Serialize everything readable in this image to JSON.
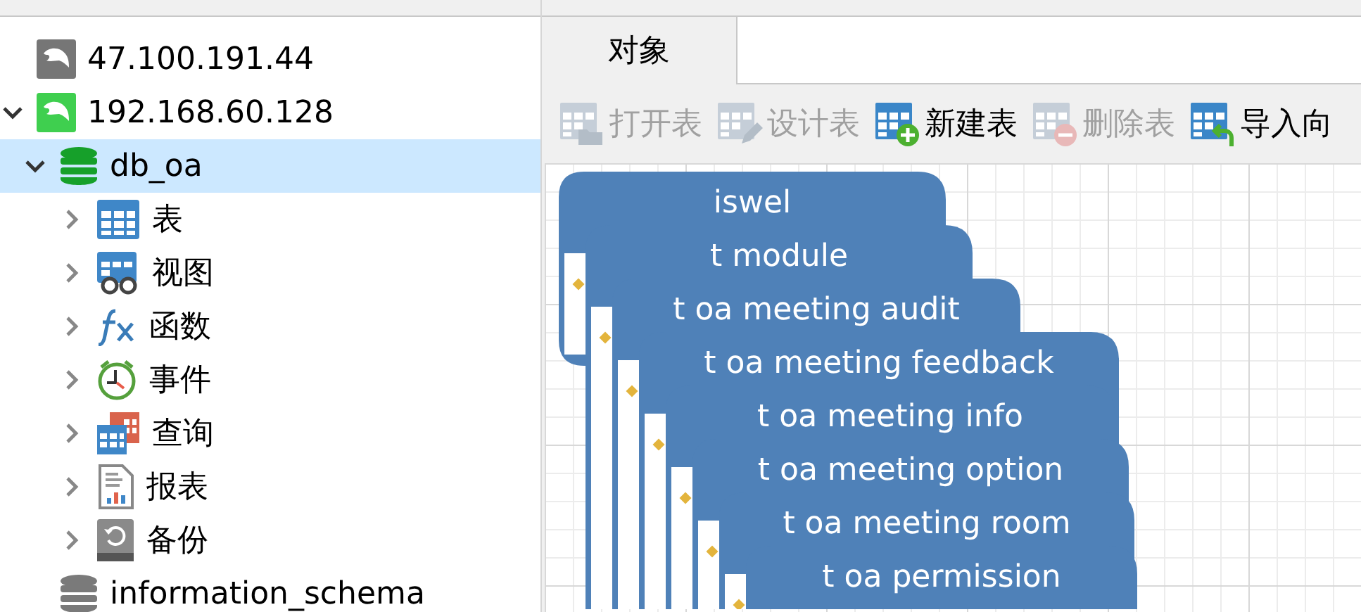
{
  "sidebar": {
    "tree": [
      {
        "label": "47.100.191.44",
        "kind": "connection",
        "open": false,
        "selected": false
      },
      {
        "label": "192.168.60.128",
        "kind": "connection",
        "open": true,
        "selected": false,
        "expanded": true,
        "children": [
          {
            "label": "db_oa",
            "kind": "database",
            "open": true,
            "selected": true,
            "expanded": true,
            "children": [
              {
                "label": "表",
                "kind": "tables",
                "selected": false,
                "expanded": false
              },
              {
                "label": "视图",
                "kind": "views",
                "selected": false,
                "expanded": false
              },
              {
                "label": "函数",
                "kind": "functions",
                "selected": false,
                "expanded": false
              },
              {
                "label": "事件",
                "kind": "events",
                "selected": false,
                "expanded": false
              },
              {
                "label": "查询",
                "kind": "queries",
                "selected": false,
                "expanded": false
              },
              {
                "label": "报表",
                "kind": "reports",
                "selected": false,
                "expanded": false
              },
              {
                "label": "备份",
                "kind": "backups",
                "selected": false,
                "expanded": false
              }
            ]
          },
          {
            "label": "information_schema",
            "kind": "database",
            "open": false,
            "selected": false
          }
        ]
      }
    ]
  },
  "tabs": [
    {
      "label": "对象",
      "selected": true
    }
  ],
  "toolbar": [
    {
      "label": "打开表",
      "kind": "open",
      "disabled": true
    },
    {
      "label": "设计表",
      "kind": "design",
      "disabled": true
    },
    {
      "label": "新建表",
      "kind": "new",
      "disabled": false
    },
    {
      "label": "删除表",
      "kind": "delete",
      "disabled": true
    },
    {
      "label": "导入向",
      "kind": "import",
      "disabled": false
    }
  ],
  "diagram": {
    "tables": [
      {
        "name": "iswel"
      },
      {
        "name": "t module"
      },
      {
        "name": "t oa meeting audit"
      },
      {
        "name": "t oa meeting feedback"
      },
      {
        "name": "t oa meeting info"
      },
      {
        "name": "t oa meeting option"
      },
      {
        "name": "t oa meeting room"
      },
      {
        "name": "t oa permission"
      }
    ]
  }
}
